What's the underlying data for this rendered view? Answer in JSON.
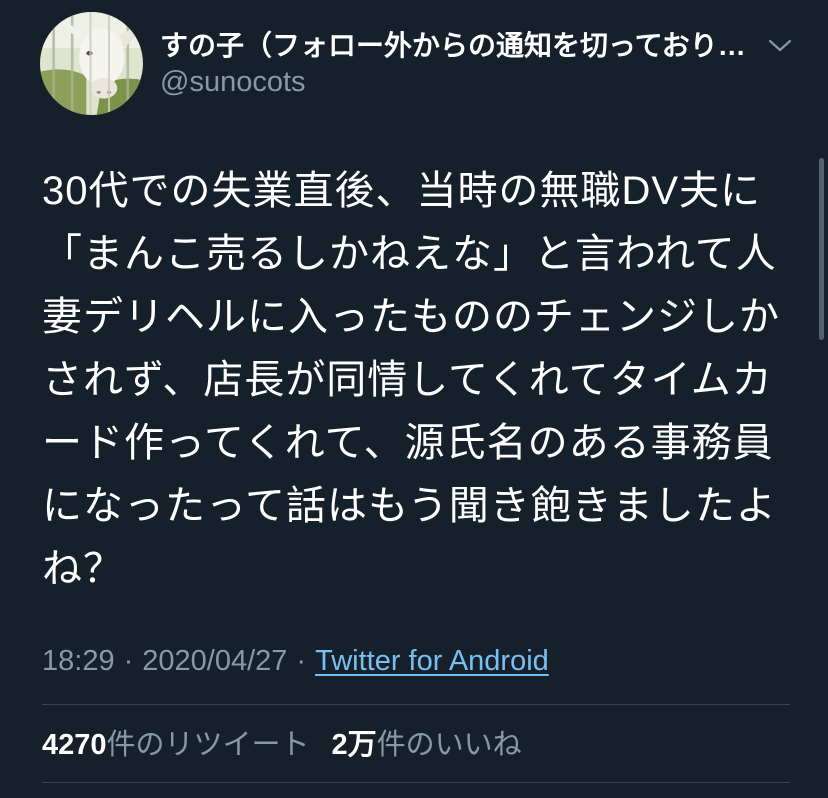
{
  "colors": {
    "background": "#15202b",
    "text": "#ffffff",
    "secondary": "#8899a6",
    "link": "#79bff2",
    "divider": "#38444d"
  },
  "icons": {
    "avatar": "goat-avatar-photo",
    "menu": "chevron-down-icon"
  },
  "header": {
    "display_name": "すの子（フォロー外からの通知を切っており…",
    "username": "@sunocots"
  },
  "tweet": {
    "lines": [
      "30代での失業直後、当時の無職DV夫に",
      "「まんこ売るしかねえな」と言われて人",
      "妻デリヘルに入ったもののチェンジしか",
      "されず、店長が同情してくれてタイムカ",
      "ード作ってくれて、源氏名のある事務員",
      "になったって話はもう聞き飽きましたよ",
      "ね？"
    ]
  },
  "meta": {
    "time": "18:29",
    "separator": "·",
    "date": "2020/04/27",
    "source": "Twitter for Android"
  },
  "stats": {
    "retweets_count": "4270",
    "retweets_label": "件のリツイート",
    "likes_count": "2万",
    "likes_label": "件のいいね"
  }
}
